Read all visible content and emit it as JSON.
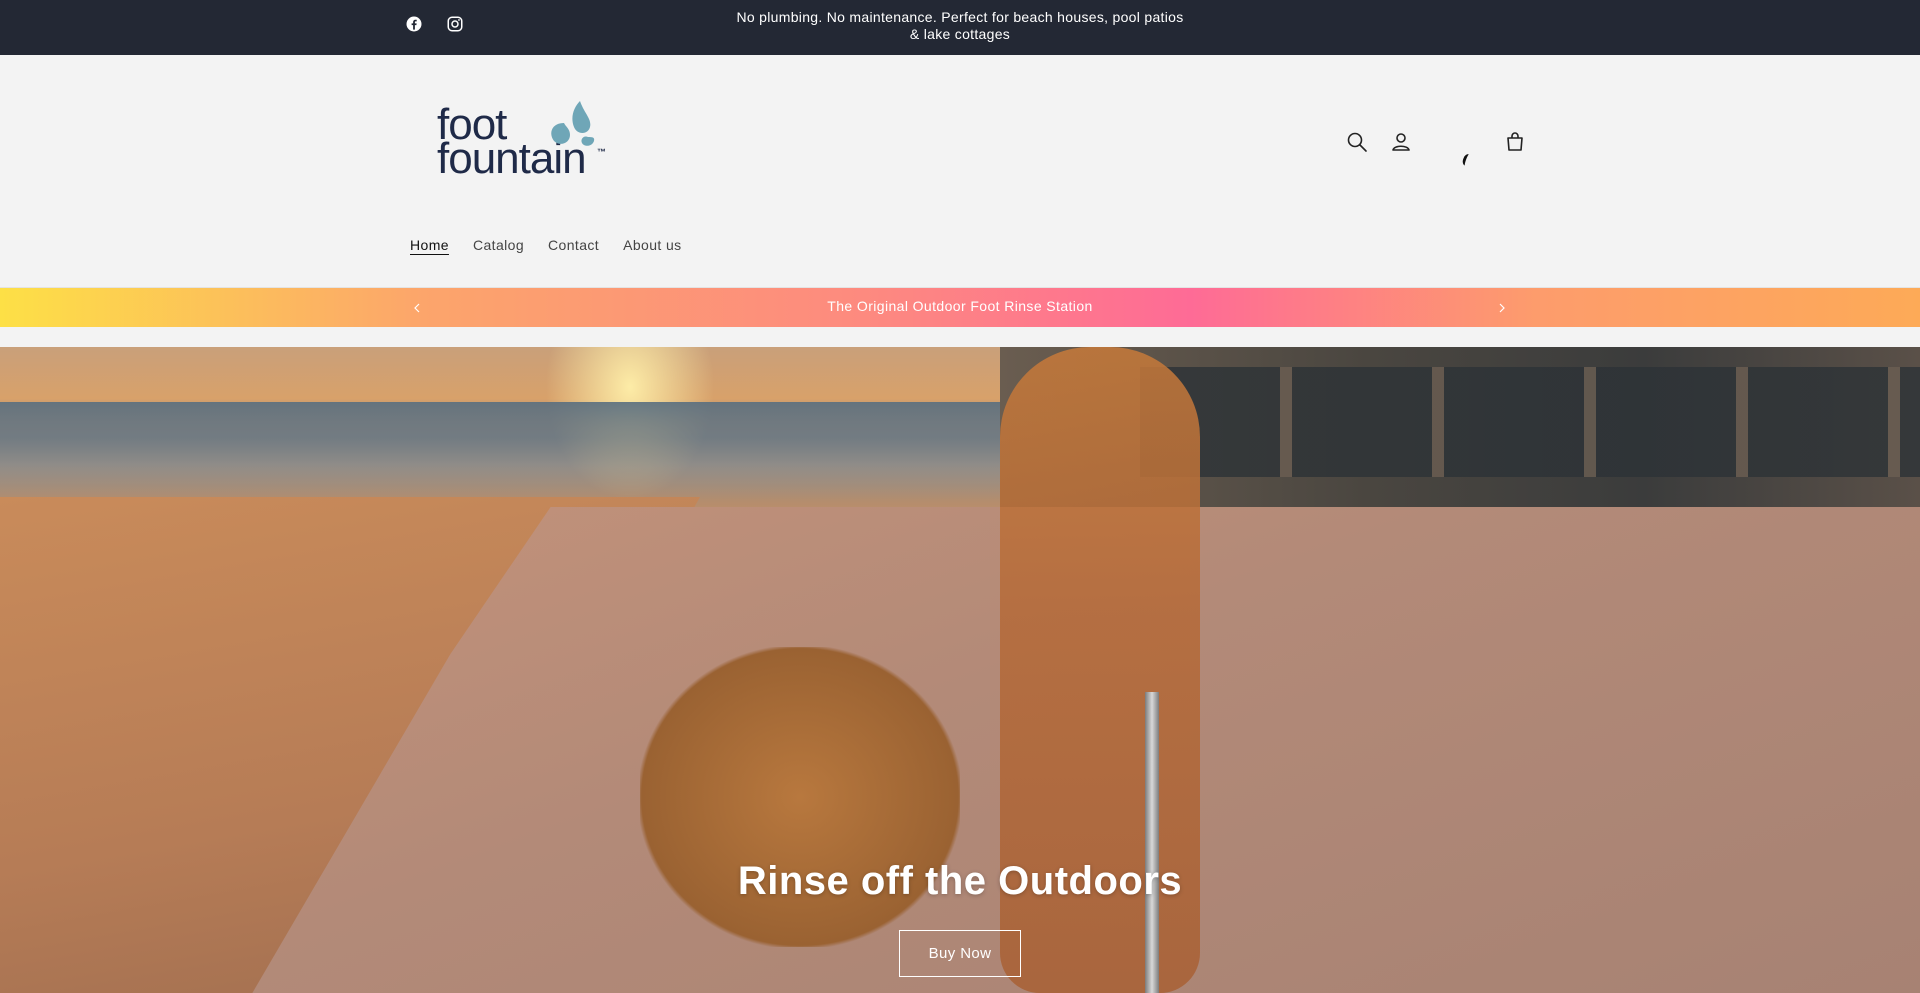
{
  "announcement": {
    "line1": "No plumbing. No maintenance. Perfect for beach houses, pool patios",
    "line2": "& lake cottages"
  },
  "social": [
    {
      "icon": "facebook-icon",
      "label": "Facebook"
    },
    {
      "icon": "instagram-icon",
      "label": "Instagram"
    }
  ],
  "logo": {
    "word1": "foot",
    "word2": "fountain",
    "tm": "™",
    "color": "#1f2a48",
    "drop_color": "#6fa6b7"
  },
  "header_icons": [
    "search-icon",
    "account-icon",
    "cart-icon"
  ],
  "nav": [
    {
      "label": "Home",
      "active": true
    },
    {
      "label": "Catalog",
      "active": false
    },
    {
      "label": "Contact",
      "active": false
    },
    {
      "label": "About us",
      "active": false
    }
  ],
  "promo": {
    "text": "The Original Outdoor Foot Rinse Station"
  },
  "hero": {
    "title": "Rinse off the Outdoors",
    "button": "Buy Now"
  },
  "colors": {
    "topbar_bg": "#232834",
    "page_bg": "#f3f3f3"
  }
}
